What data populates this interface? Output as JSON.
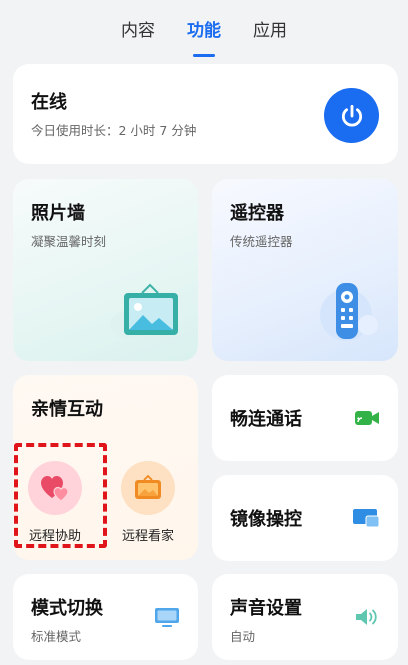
{
  "tabs": [
    {
      "label": "内容",
      "active": false
    },
    {
      "label": "功能",
      "active": true
    },
    {
      "label": "应用",
      "active": false
    }
  ],
  "online": {
    "title": "在线",
    "subtitle": "今日使用时长：2 小时 7 分钟",
    "icon": "power-icon",
    "color": "#1a6cf0"
  },
  "photo_wall": {
    "title": "照片墙",
    "subtitle": "凝聚温馨时刻",
    "icon": "picture-frame-icon"
  },
  "remote": {
    "title": "遥控器",
    "subtitle": "传统遥控器",
    "icon": "remote-control-icon"
  },
  "family": {
    "title": "亲情互动",
    "items": [
      {
        "label": "远程协助",
        "icon": "hearts-icon",
        "color": "#ec4f6a"
      },
      {
        "label": "远程看家",
        "icon": "camera-monitor-icon",
        "color": "#f08a22"
      }
    ]
  },
  "call": {
    "title": "畅连通话",
    "icon": "video-call-icon",
    "color": "#33b347"
  },
  "mirror": {
    "title": "镜像操控",
    "icon": "screen-mirror-icon",
    "color": "#2f8de4"
  },
  "mode": {
    "title": "模式切换",
    "subtitle": "标准模式",
    "icon": "monitor-icon"
  },
  "sound": {
    "title": "声音设置",
    "subtitle": "自动",
    "icon": "speaker-icon"
  }
}
